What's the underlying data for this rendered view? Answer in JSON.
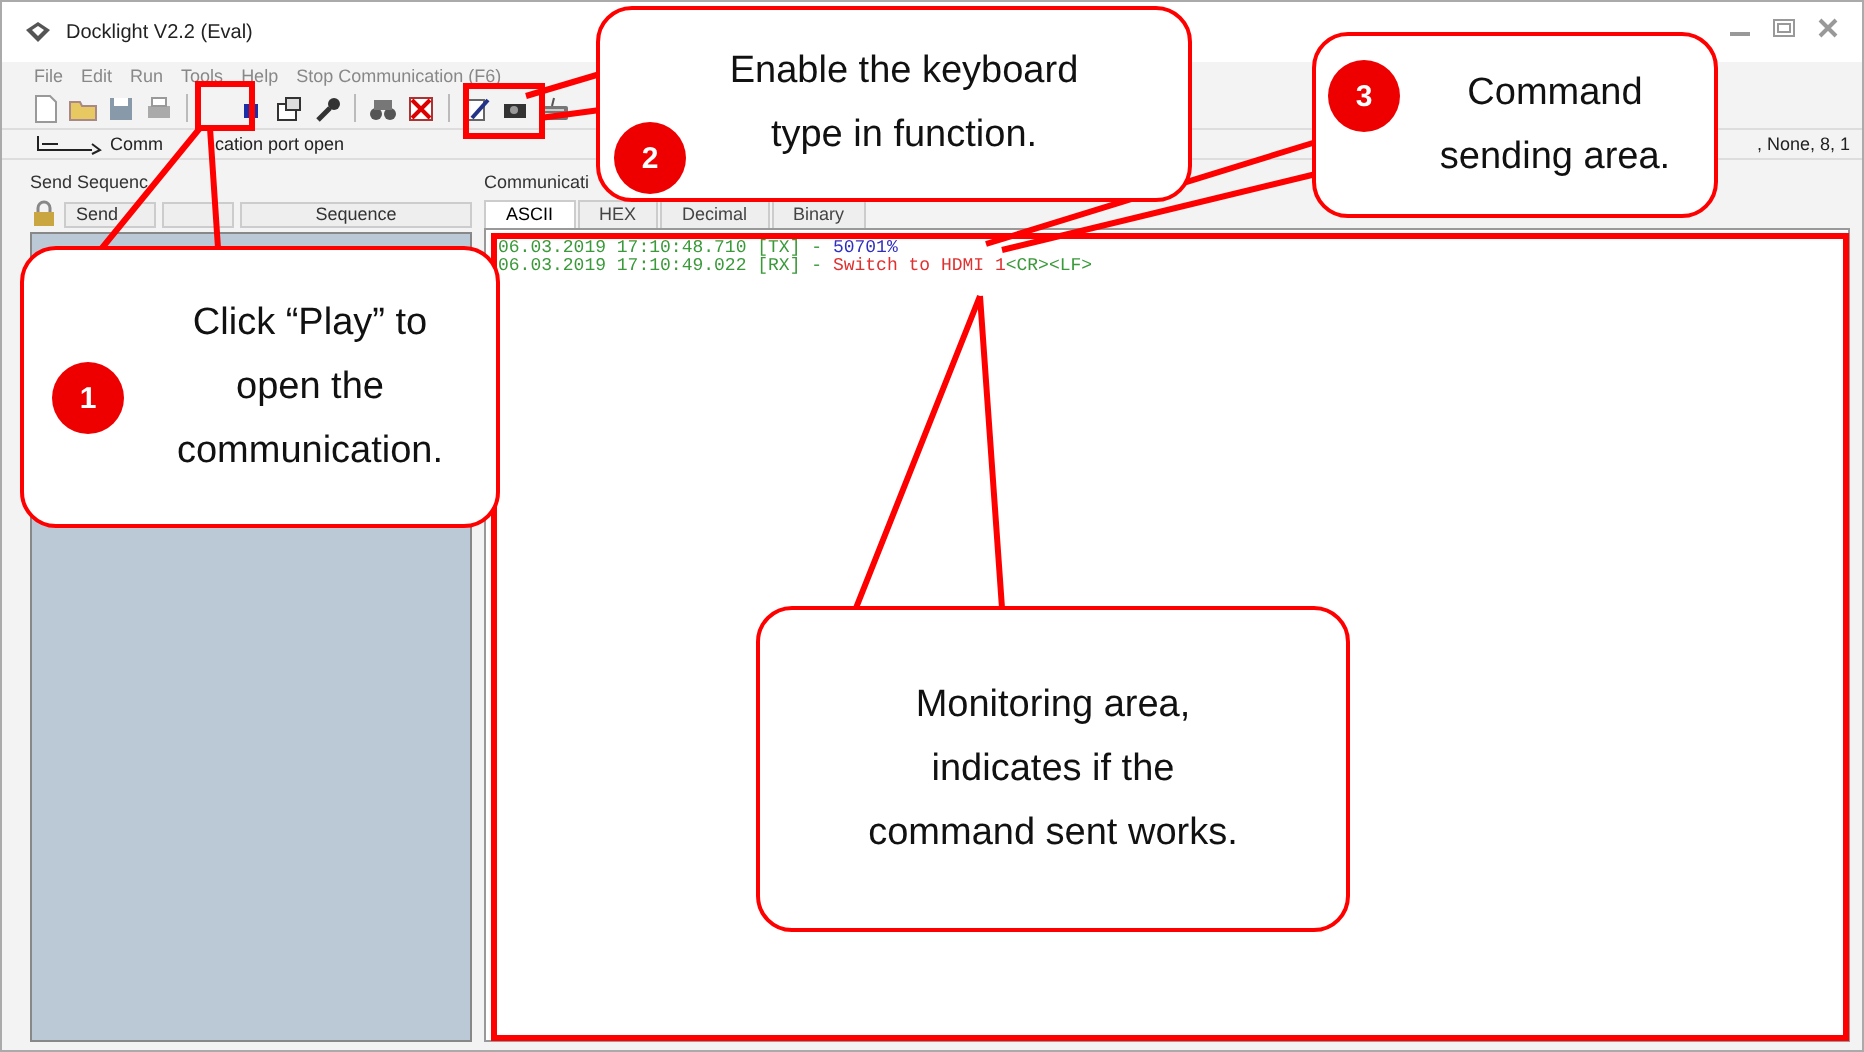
{
  "window": {
    "title": "Docklight V2.2 (Eval)"
  },
  "menu": [
    {
      "label": "File"
    },
    {
      "label": "Edit"
    },
    {
      "label": "Run"
    },
    {
      "label": "Tools"
    },
    {
      "label": "Help"
    },
    {
      "label": "Stop Communication  (F6)"
    }
  ],
  "status_line": {
    "text_parts": [
      "Comm",
      "cation port open"
    ],
    "settings": ", None, 8, 1"
  },
  "send_panel": {
    "title": "Send Sequenc",
    "columns": [
      "Send",
      "",
      "Sequence"
    ]
  },
  "communication_panel": {
    "title": "Communicati",
    "tabs": [
      {
        "label": "ASCII",
        "selected": true
      },
      {
        "label": "HEX",
        "selected": false
      },
      {
        "label": "Decimal",
        "selected": false
      },
      {
        "label": "Binary",
        "selected": false
      }
    ],
    "log": [
      {
        "kind": "tx",
        "header": "06.03.2019 17:10:48.710 [TX] - ",
        "message": "50701%"
      },
      {
        "kind": "rx",
        "header": "06.03.2019 17:10:49.022 [RX] - ",
        "message": "Switch to HDMI 1",
        "suffix": "<CR><LF>"
      }
    ]
  },
  "callouts": [
    {
      "number": "1",
      "text": "Click “Play” to open the communication."
    },
    {
      "number": "2",
      "text": "Enable the keyboard type in function."
    },
    {
      "number": "3",
      "text": "Command sending area."
    },
    {
      "text": "Monitoring area, indicates if the command sent works."
    }
  ]
}
